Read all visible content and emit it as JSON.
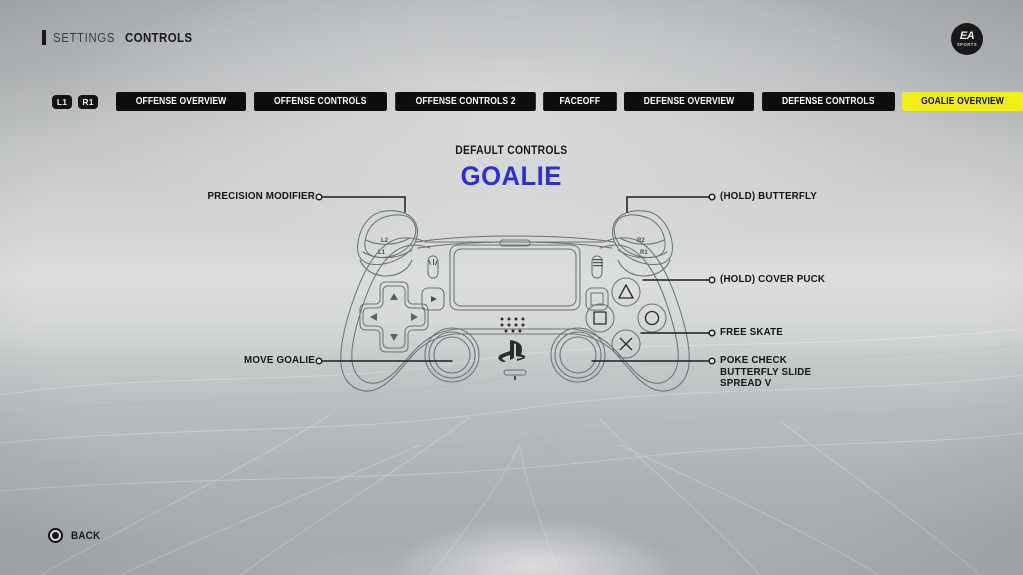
{
  "breadcrumb": {
    "parent": "SETTINGS",
    "current": "CONTROLS"
  },
  "logo": {
    "brand": "EA",
    "sub": "SPORTS"
  },
  "tabbar": {
    "bumper_left": "L1",
    "bumper_right": "R1",
    "tabs": [
      {
        "label": "OFFENSE OVERVIEW",
        "active": false
      },
      {
        "label": "OFFENSE CONTROLS",
        "active": false
      },
      {
        "label": "OFFENSE CONTROLS 2",
        "active": false
      },
      {
        "label": "FACEOFF",
        "active": false
      },
      {
        "label": "DEFENSE OVERVIEW",
        "active": false
      },
      {
        "label": "DEFENSE CONTROLS",
        "active": false
      },
      {
        "label": "GOALIE OVERVIEW",
        "active": true
      }
    ]
  },
  "heading": {
    "subtitle": "DEFAULT CONTROLS",
    "title": "GOALIE",
    "title_color": "#2c2ce0"
  },
  "callouts": {
    "precision_modifier": "PRECISION MODIFIER",
    "move_goalie": "MOVE GOALIE",
    "hold_butterfly": "(HOLD) BUTTERFLY",
    "hold_cover_puck": "(HOLD) COVER PUCK",
    "free_skate": "FREE SKATE",
    "poke_check": "POKE CHECK",
    "butterfly_slide": "BUTTERFLY SLIDE",
    "spread_v": "SPREAD V"
  },
  "controller": {
    "trigger_left_upper": "L2",
    "trigger_left_lower": "L1",
    "trigger_right_upper": "R2",
    "trigger_right_lower": "R1"
  },
  "footer": {
    "back_label": "BACK",
    "back_button_glyph": "circle-button"
  },
  "colors": {
    "active_tab": "#f2ef16",
    "tab_background": "#0d0d0f",
    "text_dark": "#17181a",
    "accent_blue": "#2c2ce0"
  }
}
